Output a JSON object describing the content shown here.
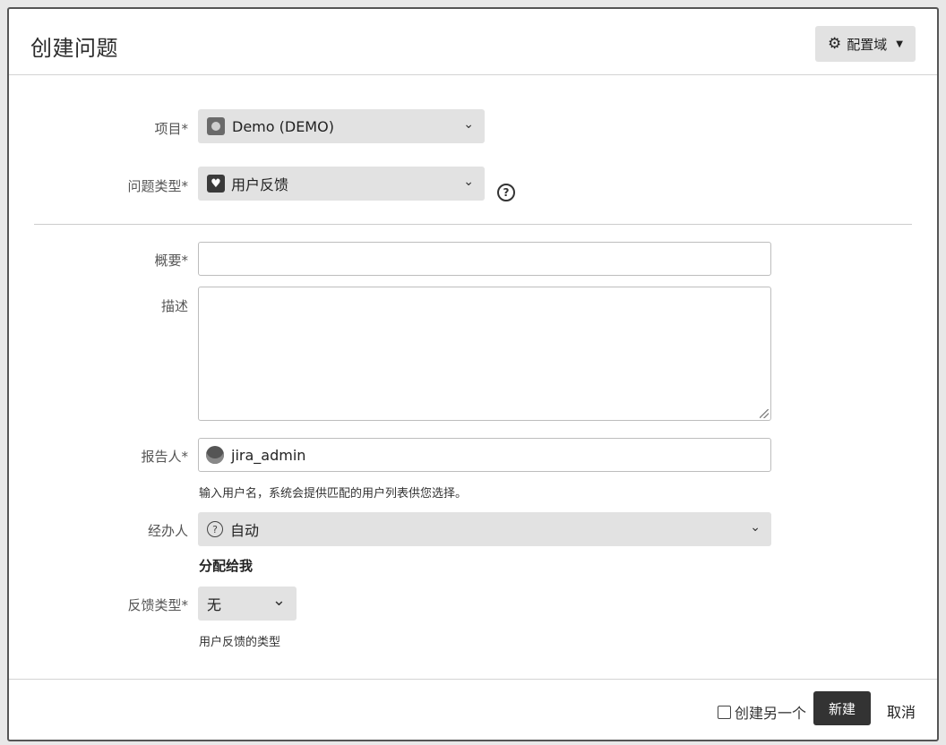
{
  "dialog": {
    "title": "创建问题",
    "config_button": "配置域"
  },
  "fields": {
    "project": {
      "label": "项目*",
      "value": "Demo (DEMO)"
    },
    "issue_type": {
      "label": "问题类型*",
      "value": "用户反馈"
    },
    "summary": {
      "label": "概要*",
      "value": ""
    },
    "description": {
      "label": "描述",
      "value": ""
    },
    "reporter": {
      "label": "报告人*",
      "value": "jira_admin",
      "hint": "输入用户名，系统会提供匹配的用户列表供您选择。"
    },
    "assignee": {
      "label": "经办人",
      "value": "自动",
      "assign_to_me": "分配给我"
    },
    "feedback_type": {
      "label": "反馈类型*",
      "value": "无",
      "hint": "用户反馈的类型"
    }
  },
  "footer": {
    "create_another": "创建另一个",
    "create_button": "新建",
    "cancel": "取消"
  },
  "icons": {
    "config": "gear-icon",
    "help": "help-icon",
    "project": "project-avatar-icon",
    "issue_type": "feedback-heart-icon",
    "reporter": "user-avatar-icon",
    "assignee": "auto-assign-icon"
  }
}
